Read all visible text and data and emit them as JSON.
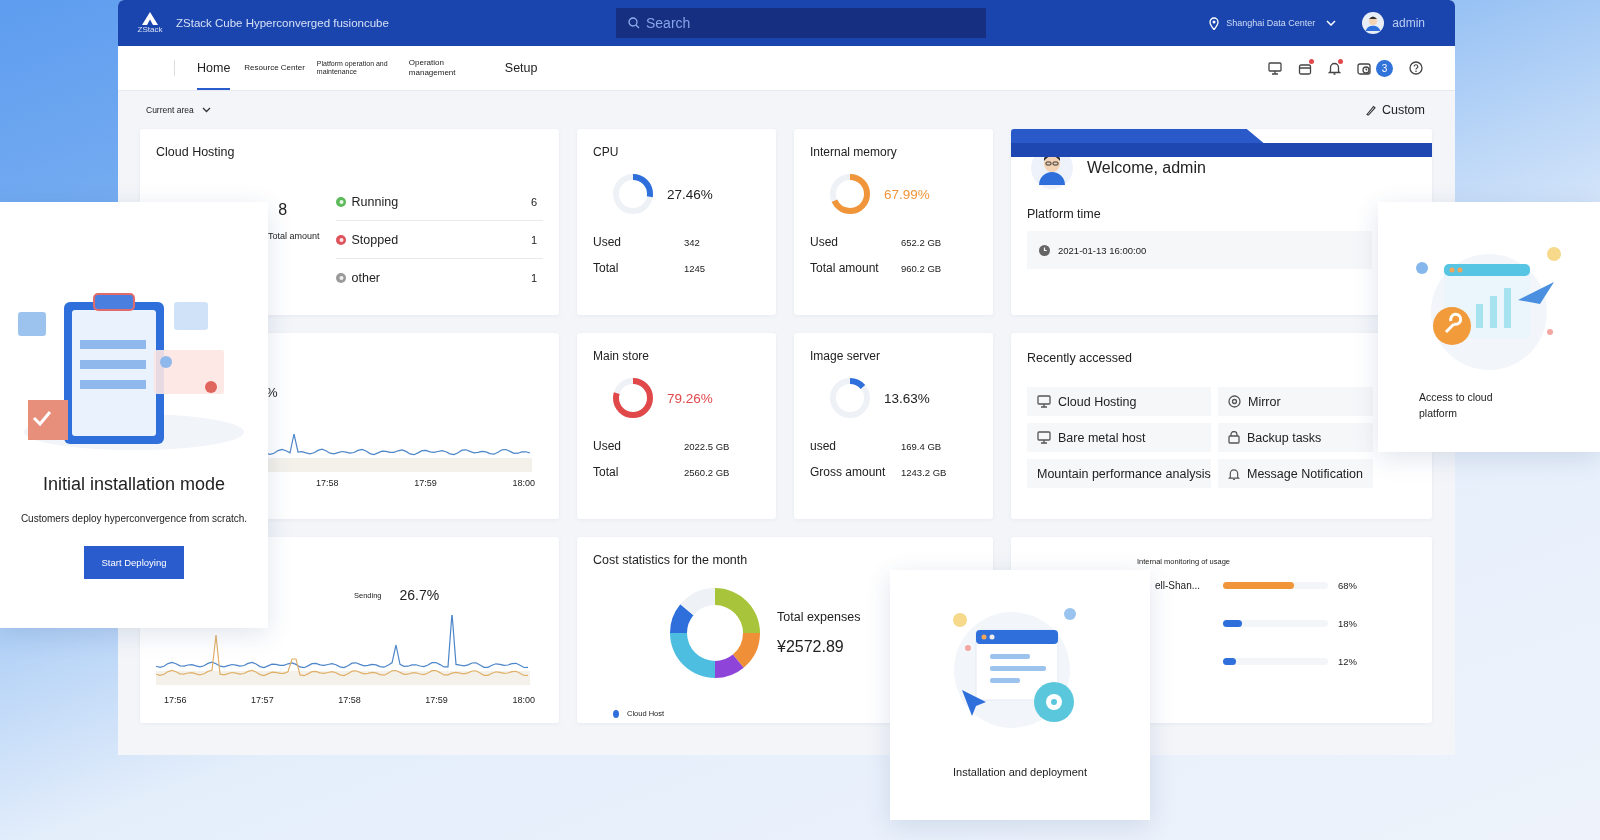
{
  "header": {
    "logo_text": "ZStack",
    "title": "ZStack Cube Hyperconverged fusioncube",
    "search": {
      "placeholder": "Search"
    },
    "region": "Shanghai Data Center",
    "user": "admin"
  },
  "nav": {
    "tabs": [
      {
        "label": "Home",
        "selected": true,
        "kind": "large"
      },
      {
        "label": "Resource Center",
        "selected": false,
        "kind": "small"
      },
      {
        "label": "Platform operation and maintenance",
        "selected": false,
        "kind": "tiny"
      },
      {
        "label": "Operation management",
        "selected": false,
        "kind": "small"
      },
      {
        "label": "Setup",
        "selected": false,
        "kind": "large"
      }
    ],
    "tools": [
      {
        "kind": "monitor"
      },
      {
        "kind": "box",
        "dot": true
      },
      {
        "kind": "bell",
        "dot": true
      },
      {
        "kind": "camera",
        "badge": "3"
      },
      {
        "kind": "help"
      }
    ]
  },
  "toolbar": {
    "area": "Current area",
    "custom": "Custom"
  },
  "cloud_hosting": {
    "title": "Cloud Hosting",
    "total": "8",
    "total_label": "Total amount",
    "statuses": [
      {
        "label": "Running",
        "count": "6",
        "color": "#5cba5a"
      },
      {
        "label": "Stopped",
        "count": "1",
        "color": "#e0525a"
      },
      {
        "label": "other",
        "count": "1",
        "color": "#9a9a9a"
      }
    ]
  },
  "gauges": [
    {
      "title": "CPU",
      "value": "27.46%",
      "level": 0.2746,
      "color": "#2f6fdc",
      "rows": [
        {
          "label": "Used",
          "value": "342"
        },
        {
          "label": "Total",
          "value": "1245"
        }
      ]
    },
    {
      "title": "Internal memory",
      "value": "67.99%",
      "level": 0.6799,
      "color": "#f0953a",
      "rows": [
        {
          "label": "Used",
          "value": "652.2 GB"
        },
        {
          "label": "Total amount",
          "value": "960.2 GB"
        }
      ]
    },
    {
      "title": "Main store",
      "value": "79.26%",
      "level": 0.7926,
      "color": "#e0484a",
      "rows": [
        {
          "label": "Used",
          "value": "2022.5 GB"
        },
        {
          "label": "Total",
          "value": "2560.2 GB"
        }
      ]
    },
    {
      "title": "Image server",
      "value": "13.63%",
      "level": 0.1363,
      "color": "#2f6fdc",
      "rows": [
        {
          "label": "used",
          "value": "169.4 GB"
        },
        {
          "label": "Gross amount",
          "value": "1243.2 GB"
        }
      ]
    }
  ],
  "welcome": {
    "greeting": "Welcome, admin",
    "time_label": "Platform time",
    "time": "2021-01-13 16:00:00"
  },
  "usage_card": {
    "value": "%",
    "ticks": [
      "17:58",
      "17:59",
      "18:00"
    ]
  },
  "recent": {
    "title": "Recently accessed",
    "items": [
      {
        "label": "Cloud Hosting",
        "kind": "monitor"
      },
      {
        "label": "Mirror",
        "kind": "disc"
      },
      {
        "label": "Bare metal host",
        "kind": "monitor"
      },
      {
        "label": "Backup tasks",
        "kind": "lock"
      },
      {
        "label": "Mountain performance analysis",
        "kind": "text"
      },
      {
        "label": "Message Notification",
        "kind": "bell"
      }
    ]
  },
  "network_card": {
    "legend": "Sending",
    "value": "26.7%",
    "ticks": [
      "17:56",
      "17:57",
      "17:58",
      "17:59",
      "18:00"
    ]
  },
  "cost": {
    "title": "Cost statistics for the month",
    "total_label": "Total expenses",
    "total": "¥2572.89",
    "legend": "Cloud Host"
  },
  "top5": {
    "subtitle": "Internal monitoring of usage",
    "rows": [
      {
        "name": "ell-Shan...",
        "level": 0.68,
        "value": "68%",
        "color": "#f0953a"
      },
      {
        "level": 0.18,
        "value": "18%",
        "color": "#2f6fdc"
      },
      {
        "level": 0.12,
        "value": "12%",
        "color": "#2f6fdc"
      }
    ]
  },
  "overlays": [
    {
      "kind": "install",
      "title": "Initial installation mode",
      "text": "Customers deploy hyperconvergence from scratch.",
      "button": "Start Deploying"
    },
    {
      "kind": "cloud",
      "caption": "Access to cloud platform"
    },
    {
      "kind": "deploy",
      "caption": "Installation and deployment"
    }
  ]
}
